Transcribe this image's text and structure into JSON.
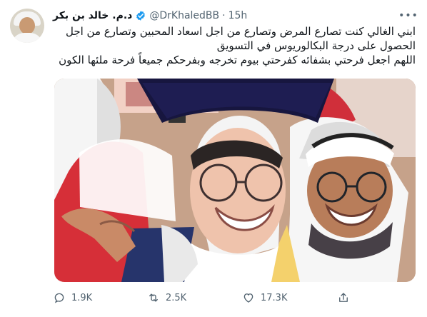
{
  "tweet": {
    "display_name": "د.م. خالد بن بكر",
    "handle": "@DrKhaledBB",
    "separator": "·",
    "time": "15h",
    "more_label": "•••",
    "lines": [
      "ابني الغالي كنت تصارع المرض وتصارع من اجل اسعاد المحبين وتصارع من اجل",
      "الحصول على درجة البكالوريوس في التسويق",
      "اللهم اجعل فرحتي بشفائه كفرحتي بيوم تخرجه وبفرحكم جميعاً فرحة ملئها الكون"
    ],
    "replies": "1.9K",
    "retweets": "2.5K",
    "likes": "17.3K"
  },
  "icons": {
    "verified": "verified-badge-icon",
    "more": "more-options-icon",
    "reply": "reply-icon",
    "retweet": "retweet-icon",
    "like": "like-icon",
    "share": "share-icon"
  },
  "colors": {
    "verified": "#1d9bf0",
    "muted": "#536471",
    "text": "#0f1419"
  }
}
